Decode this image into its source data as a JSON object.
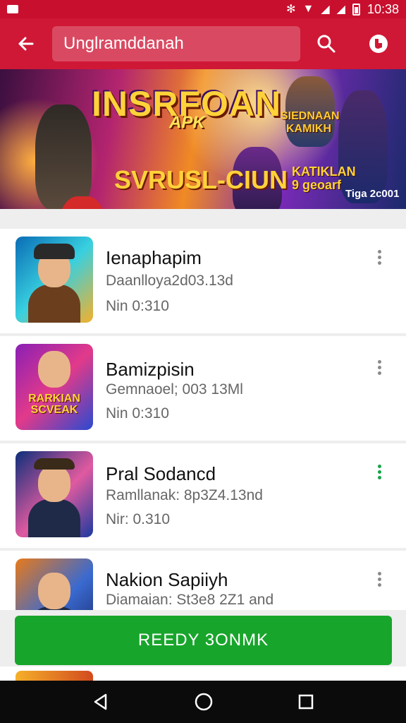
{
  "status_bar": {
    "time": "10:38",
    "icons": [
      "notification-icon",
      "bluetooth-icon",
      "wifi-icon",
      "signal-icon",
      "signal-icon",
      "battery-icon"
    ]
  },
  "app_bar": {
    "search_text": "Unglramddanah",
    "icons": [
      "back-arrow-icon",
      "search-icon",
      "shield-icon"
    ]
  },
  "banner": {
    "title": "INSRFOAN",
    "tag": "APK",
    "subtitle": "SVRUSL-CIUN",
    "side_text": "SIEDNAAN KAMIKH",
    "rated_text": "KATIKLAN",
    "rated_sub": "9 geoarf",
    "year": "Tiga 2c001",
    "colors": {
      "pink": "#b3246f",
      "orange": "#f08a24",
      "purple": "#7a2ab8",
      "yellow": "#ffd23a"
    }
  },
  "apps": [
    {
      "name": "Ienaphapim",
      "detail": "Daanlloya2d03.13d",
      "version": "Nin 0:310",
      "thumb_text": ""
    },
    {
      "name": "Bamizpisin",
      "detail": "Gemnaoel; 003 13Ml",
      "version": "Nin 0:310",
      "thumb_text": "RARKIAN SCVEAK"
    },
    {
      "name": "Pral Sodancd",
      "detail": "Ramllanak: 8p3Z4.13nd",
      "version": "Nir: 0.310",
      "thumb_text": ""
    },
    {
      "name": "Nakion Sapiiyh",
      "detail": "Diamaian: St3e8 2Z1 and",
      "version": "",
      "thumb_text": ""
    }
  ],
  "actions": {
    "ready_label": "REEDY 3ONMK",
    "ready_color": "#18a52b"
  },
  "nav": {
    "icons": [
      "back-triangle-icon",
      "home-circle-icon",
      "recents-square-icon"
    ]
  }
}
